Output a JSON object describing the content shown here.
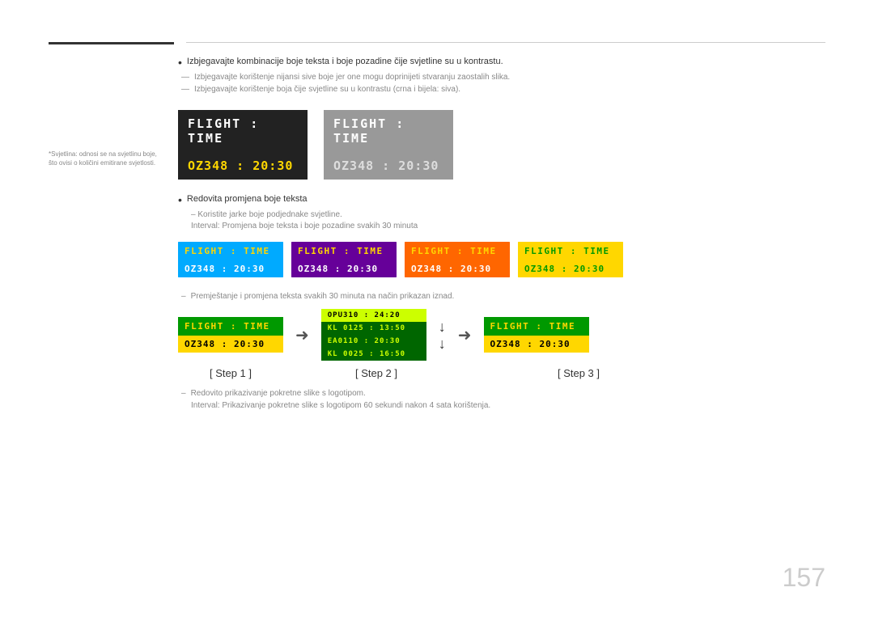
{
  "page": {
    "number": "157"
  },
  "sidebar": {
    "note": "*Svjetlina: odnosi se na svjetlinu boje, što ovisi o količini emitirane svjetlosti."
  },
  "bullets": {
    "item1": "Izbjegavajte kombinacije boje teksta i boje pozadine čije svjetline su u kontrastu.",
    "dash1": "Izbjegavajte korištenje nijansi sive boje jer one mogu doprinijeti stvaranju zaostalih slika.",
    "dash2": "Izbjegavajte korištenje boja čije svjetline su u kontrastu (crna i bijela: siva).",
    "item2": "Redovita promjena boje teksta",
    "sub1": "Koristite jarke boje podjednake svjetline.",
    "sub2": "Interval: Promjena boje teksta i boje pozadine svakih 30 minuta",
    "dash3": "Premještanje i promjena teksta svakih 30 minuta na način prikazan iznad.",
    "note1": "Redovito prikazivanje pokretne slike s logotipom.",
    "note2": "Interval: Prikazivanje pokretne slike s logotipom 60 sekundi nakon 4 sata korištenja."
  },
  "boards": {
    "primary": [
      {
        "bg": "#222222",
        "headerColor": "#ffffff",
        "headerText": "FLIGHT  :  TIME",
        "bodyBg": "#222222",
        "bodyColor": "#FFD700",
        "bodyText": "OZ348   :  20:30"
      },
      {
        "bg": "#999999",
        "headerColor": "#ffffff",
        "headerText": "FLIGHT  :  TIME",
        "bodyBg": "#999999",
        "bodyColor": "#cccccc",
        "bodyText": "OZ348   :  20:30"
      }
    ],
    "color_variants": [
      {
        "headerBg": "#00AAFF",
        "headerColor": "#FFD700",
        "headerText": "FLIGHT  :  TIME",
        "bodyBg": "#00AAFF",
        "bodyColor": "#ffffff",
        "bodyText": "OZ348   :  20:30"
      },
      {
        "headerBg": "#660099",
        "headerColor": "#FFD700",
        "headerText": "FLIGHT  :  TIME",
        "bodyBg": "#660099",
        "bodyColor": "#ffffff",
        "bodyText": "OZ348   :  20:30"
      },
      {
        "headerBg": "#FF6600",
        "headerColor": "#FFD700",
        "headerText": "FLIGHT  :  TIME",
        "bodyBg": "#FF6600",
        "bodyColor": "#ffffff",
        "bodyText": "OZ348   :  20:30"
      },
      {
        "headerBg": "#FFD700",
        "headerColor": "#009900",
        "headerText": "FLIGHT  :  TIME",
        "bodyBg": "#FFD700",
        "bodyColor": "#009900",
        "bodyText": "OZ348   :  20:30"
      }
    ],
    "steps": {
      "step1": {
        "headerBg": "#009900",
        "headerColor": "#FFD700",
        "headerText": "FLIGHT  :  TIME",
        "bodyBg": "#FFD700",
        "bodyColor": "#000000",
        "bodyText": "OZ348   :  20:30"
      },
      "step2_rows": [
        {
          "bg": "#CCFF00",
          "color": "#000000",
          "text": "OPU310  :  24:20"
        },
        {
          "bg": "#006600",
          "color": "#CCFF00",
          "text": "KL 0125  :  13:50"
        },
        {
          "bg": "#006600",
          "color": "#CCFF00",
          "text": "EA0110  :  20:30"
        },
        {
          "bg": "#006600",
          "color": "#CCFF00",
          "text": "KL 0025  :  16:50"
        }
      ],
      "step3": {
        "headerBg": "#009900",
        "headerColor": "#FFD700",
        "headerText": "FLIGHT  :  TIME",
        "bodyBg": "#FFD700",
        "bodyColor": "#000000",
        "bodyText": "OZ348   :  20:30"
      }
    },
    "step_labels": [
      "[ Step 1 ]",
      "[ Step 2 ]",
      "[ Step 3 ]"
    ]
  }
}
